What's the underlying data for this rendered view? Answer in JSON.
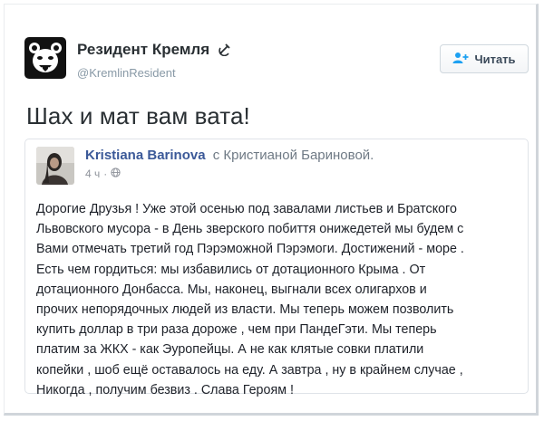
{
  "tweet": {
    "author_name": "Резидент Кремля",
    "author_handle": "@KremlinResident",
    "follow_label": "Читать",
    "text": "Шах и мат вам вата!"
  },
  "quoted_post": {
    "author_name": "Kristiana Barinova",
    "with_text": "с Кристианой Бариновой.",
    "time": "4 ч",
    "body_lines": [
      "Дорогие Друзья ! Уже этой осенью под завалами листьев и Братского",
      "Львовского мусора - в День зверского побиття онижедетей мы будем с",
      "Вами отмечать третий год Пэрэможной Пэрэмоги. Достижений - море .",
      "Есть чем гордиться: мы избавились от дотационного Крыма . От",
      "дотационного Донбасса. Мы, наконец, выгнали всех олигархов и",
      "прочих непорядочных людей из власти. Мы теперь можем позволить",
      "купить доллар в три раза дороже , чем при ПандеГэти. Мы теперь",
      "платим за ЖКХ - как Эуропейцы. А не как клятые совки платили",
      "копейки , шоб ещё оставалось на еду. А завтра , ну в крайнем случае ,",
      "Никогда , получим безвиз . Слава Героям !"
    ]
  },
  "icons": {
    "avatar": "bear-logo-icon",
    "name_badge": "hammer-sickle-icon",
    "follow": "add-user-icon",
    "privacy": "globe-icon"
  },
  "colors": {
    "link_name": "#3b5998",
    "follow_icon": "#1da1f2",
    "text": "#292f33",
    "muted": "#8899a6"
  }
}
